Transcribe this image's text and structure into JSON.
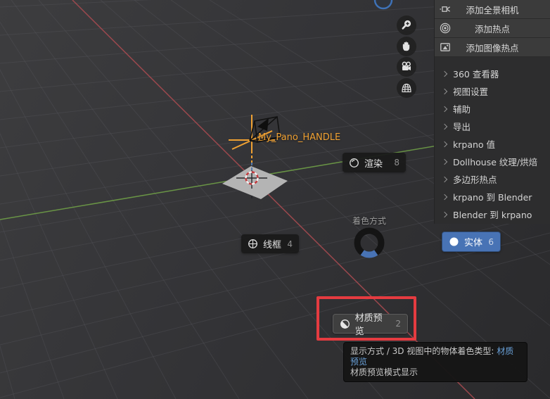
{
  "viewport": {
    "object_label": "My_Pano_HANDLE",
    "colors": {
      "axis_x": "#a64a50",
      "axis_y": "#6f9e47",
      "active_object_orange": "#f0a132",
      "selection_blue": "#4873b5",
      "highlight_red": "#e53b40",
      "tooltip_link_blue": "#6aa1d9"
    }
  },
  "nav_toolbar": {
    "buttons": [
      {
        "icon": "zoom-in-icon"
      },
      {
        "icon": "pan-hand-icon"
      },
      {
        "icon": "camera-view-icon"
      },
      {
        "icon": "perspective-grid-icon"
      }
    ],
    "gizmo_icon": "navigation-orbit-circle"
  },
  "pie_menu": {
    "title": "着色方式",
    "items": [
      {
        "label": "渲染",
        "key": "8",
        "icon": "rendered-shading-icon"
      },
      {
        "label": "线框",
        "key": "4",
        "icon": "wireframe-shading-icon"
      },
      {
        "label": "实体",
        "key": "6",
        "icon": "solid-shading-icon",
        "selected": true
      },
      {
        "label": "材质预览",
        "key": "2",
        "icon": "material-preview-shading-icon",
        "highlighted": true
      }
    ]
  },
  "sidebar": {
    "buttons": [
      {
        "icon": "pano-camera-icon",
        "label": "添加全景相机"
      },
      {
        "icon": "hotspot-icon",
        "label": "添加热点"
      },
      {
        "icon": "image-hotspot-icon",
        "label": "添加图像热点"
      }
    ],
    "panels": [
      "360 查看器",
      "视图设置",
      "辅助",
      "导出",
      "krpano 值",
      "Dollhouse 纹理/烘焙",
      "多边形热点",
      "krpano 到 Blender",
      "Blender 到 krpano"
    ]
  },
  "tooltip": {
    "line1": "显示方式 / 3D 视图中的物体着色类型:",
    "line1_highlight": "材质预览",
    "line2": "材质预览模式显示"
  }
}
